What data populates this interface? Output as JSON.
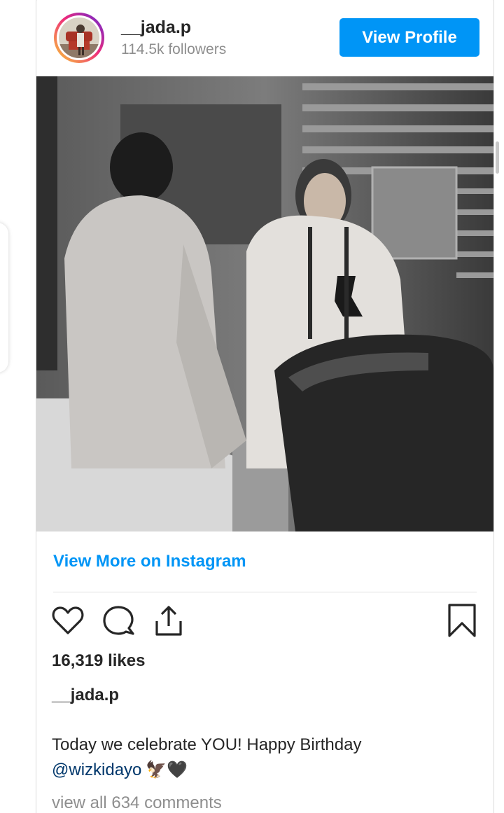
{
  "profile": {
    "username": "__jada.p",
    "followers": "114.5k followers",
    "view_profile_label": "View Profile"
  },
  "post": {
    "view_more_label": "View More on Instagram",
    "likes": "16,319 likes",
    "caption_username": "__jada.p",
    "caption_text": "Today we celebrate YOU! Happy Birthday",
    "caption_mention": "@wizkidayo",
    "caption_emojis": "🦅🖤",
    "comments_link": "view all 634 comments"
  },
  "icons": {
    "like": "heart-icon",
    "comment": "comment-bubble-icon",
    "share": "share-icon",
    "save": "bookmark-icon"
  },
  "colors": {
    "accent": "#0095f6",
    "text": "#262626",
    "muted": "#8e8e8e",
    "mention": "#00376b"
  }
}
